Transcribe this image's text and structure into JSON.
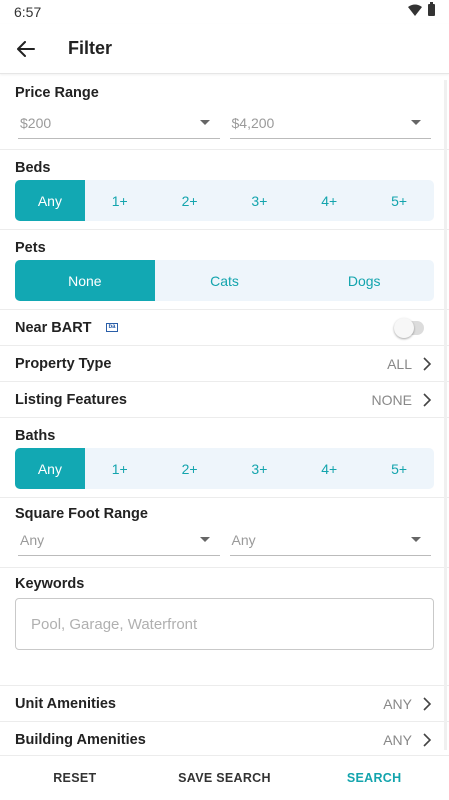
{
  "status_bar": {
    "time": "6:57"
  },
  "header": {
    "title": "Filter"
  },
  "price_range": {
    "title": "Price Range",
    "min": "$200",
    "max": "$4,200"
  },
  "beds": {
    "title": "Beds",
    "options": [
      "Any",
      "1+",
      "2+",
      "3+",
      "4+",
      "5+"
    ],
    "selected": "Any"
  },
  "pets": {
    "title": "Pets",
    "options": [
      "None",
      "Cats",
      "Dogs"
    ],
    "selected": "None"
  },
  "near_bart": {
    "label": "Near BART",
    "badge": "ba",
    "enabled": false
  },
  "property_type": {
    "label": "Property Type",
    "value": "ALL"
  },
  "listing_features": {
    "label": "Listing Features",
    "value": "NONE"
  },
  "baths": {
    "title": "Baths",
    "options": [
      "Any",
      "1+",
      "2+",
      "3+",
      "4+",
      "5+"
    ],
    "selected": "Any"
  },
  "square_foot_range": {
    "title": "Square Foot Range",
    "min": "Any",
    "max": "Any"
  },
  "keywords": {
    "title": "Keywords",
    "placeholder": "Pool, Garage, Waterfront",
    "value": ""
  },
  "unit_amenities": {
    "label": "Unit Amenities",
    "value": "ANY"
  },
  "building_amenities": {
    "label": "Building Amenities",
    "value": "ANY"
  },
  "footer": {
    "reset": "RESET",
    "save_search": "SAVE SEARCH",
    "search": "SEARCH"
  },
  "colors": {
    "accent": "#12a8b3",
    "segment_bg": "#eef5fb"
  },
  "icons": {
    "back": "back-arrow-icon",
    "chevron": "chevron-right-icon",
    "wifi": "wifi-icon",
    "battery": "battery-icon"
  }
}
